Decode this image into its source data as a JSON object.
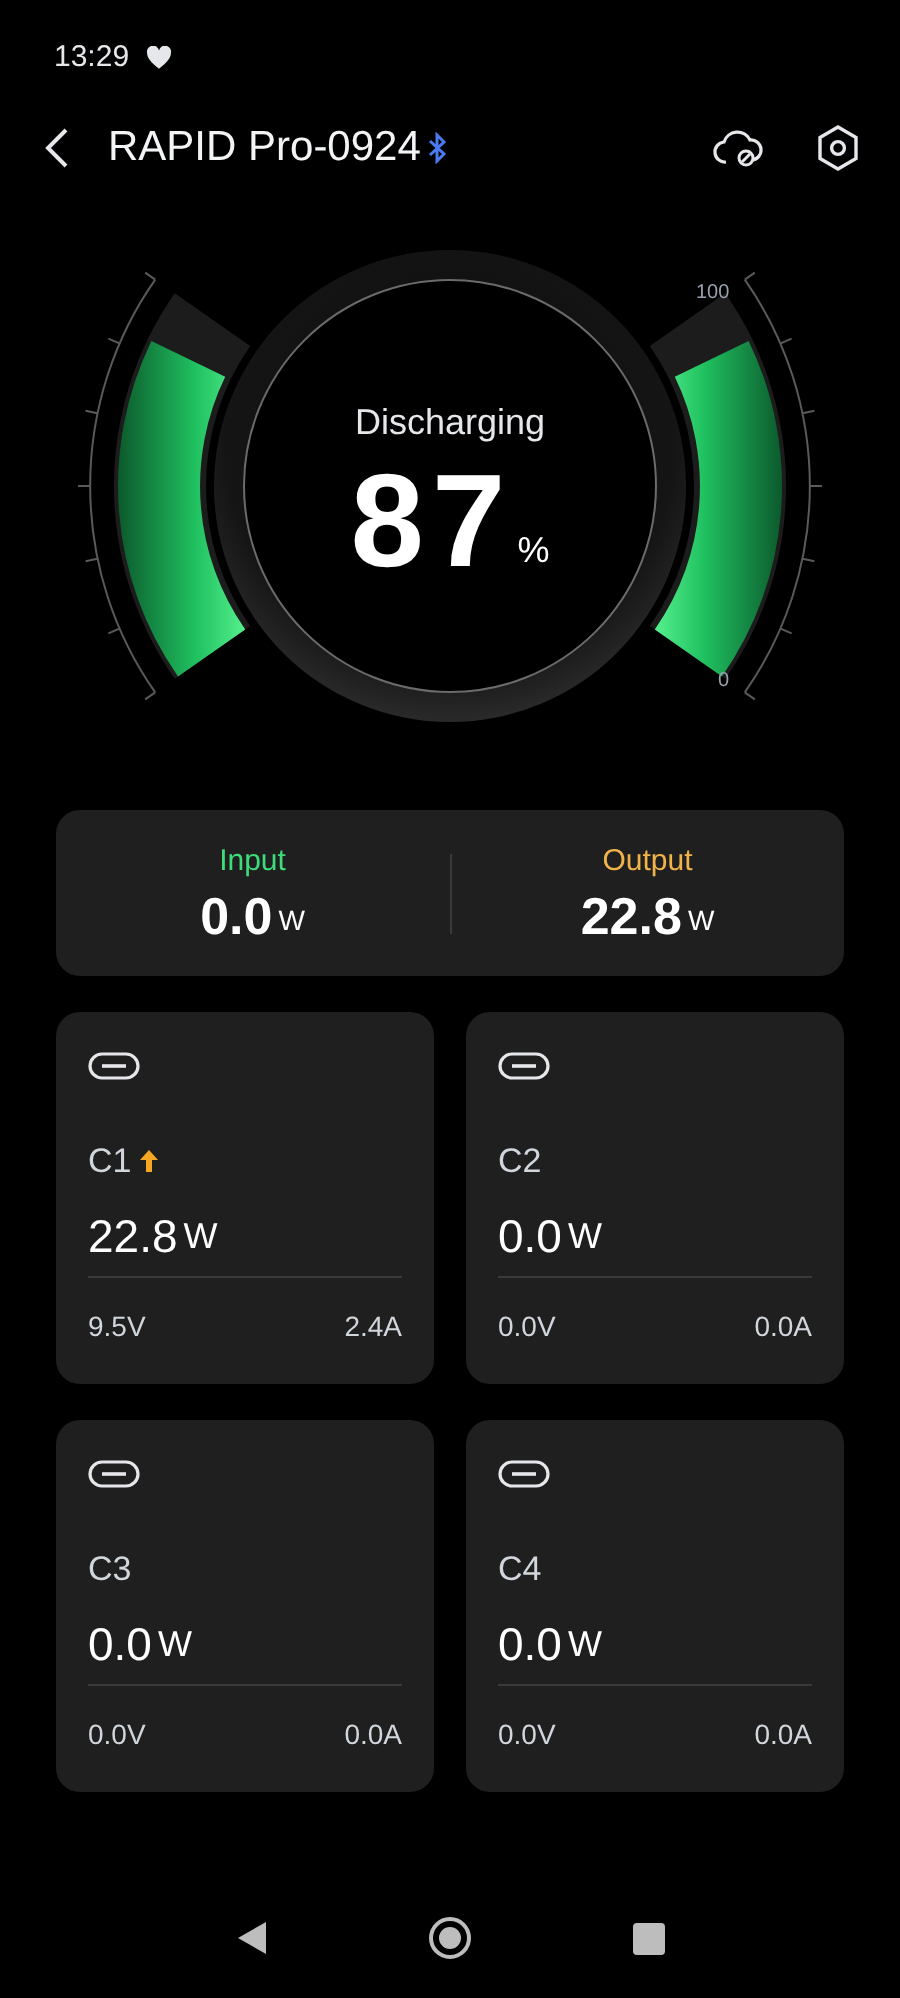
{
  "status_bar": {
    "time": "13:29"
  },
  "header": {
    "title": "RAPID Pro-0924",
    "bluetooth_connected": true
  },
  "gauge": {
    "status": "Discharging",
    "percent": "87",
    "unit": "%",
    "scale_max": "100",
    "scale_min": "0"
  },
  "power_summary": [
    {
      "kind": "input",
      "label": "Input",
      "value": "0.0",
      "unit": "W"
    },
    {
      "kind": "output",
      "label": "Output",
      "value": "22.8",
      "unit": "W"
    }
  ],
  "ports": [
    {
      "name": "C1",
      "outputting": true,
      "power": "22.8",
      "unit": "W",
      "voltage": "9.5V",
      "current": "2.4A"
    },
    {
      "name": "C2",
      "outputting": false,
      "power": "0.0",
      "unit": "W",
      "voltage": "0.0V",
      "current": "0.0A"
    },
    {
      "name": "C3",
      "outputting": false,
      "power": "0.0",
      "unit": "W",
      "voltage": "0.0V",
      "current": "0.0A"
    },
    {
      "name": "C4",
      "outputting": false,
      "power": "0.0",
      "unit": "W",
      "voltage": "0.0V",
      "current": "0.0A"
    }
  ]
}
